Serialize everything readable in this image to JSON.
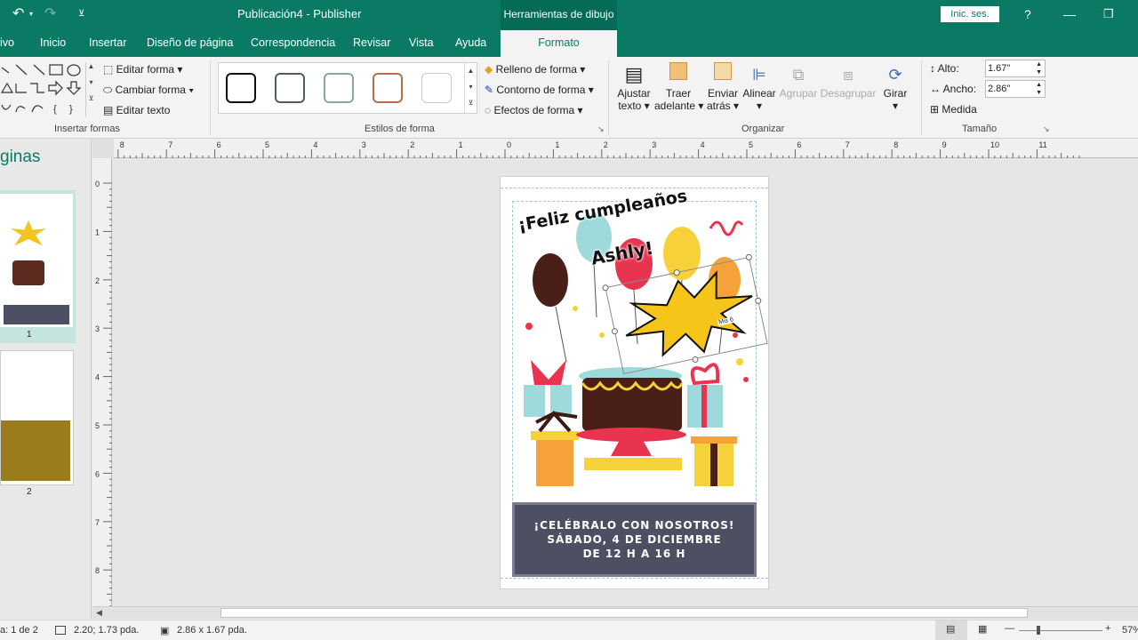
{
  "titlebar": {
    "doc_title": "Publicación4  -  Publisher",
    "drawing_tools": "Herramientas de dibujo",
    "signin": "Inic. ses.",
    "help": "?"
  },
  "tabs": [
    {
      "label": "ivo"
    },
    {
      "label": "Inicio"
    },
    {
      "label": "Insertar"
    },
    {
      "label": "Diseño de página"
    },
    {
      "label": "Correspondencia"
    },
    {
      "label": "Revisar"
    },
    {
      "label": "Vista"
    },
    {
      "label": "Ayuda"
    },
    {
      "label": "Formato"
    }
  ],
  "ribbon": {
    "insert_shapes": {
      "edit_shape": "Editar forma",
      "change_shape": "Cambiar forma",
      "edit_text": "Editar texto",
      "label": "Insertar formas"
    },
    "shape_styles": {
      "fill": "Relleno de forma",
      "outline": "Contorno de forma",
      "effects": "Efectos de forma",
      "label": "Estilos de forma",
      "swatch_colors": [
        "#111111",
        "#555b66",
        "#8aa6a8",
        "#b5704a",
        "#c8c8c8"
      ]
    },
    "arrange": {
      "wrap_text": "Ajustar",
      "wrap_text2": "texto",
      "bring_forward": "Traer",
      "bring_forward2": "adelante",
      "send_backward": "Enviar",
      "send_backward2": "atrás",
      "align": "Alinear",
      "group": "Agrupar",
      "ungroup": "Desagrupar",
      "rotate": "Girar",
      "label": "Organizar"
    },
    "size": {
      "height_label": "Alto:",
      "height_value": "1.67\"",
      "width_label": "Ancho:",
      "width_value": "2.86\"",
      "measure": "Medida",
      "label": "Tamaño"
    }
  },
  "pages_pane": {
    "title": "ginas",
    "thumb1_num": "1",
    "thumb2_num": "2"
  },
  "flyer": {
    "title_line1": "¡Feliz cumpleaños",
    "title_line2": "Ashly!",
    "burst_text": "Mis 6",
    "banner_line1": "¡CELÉBRALO CON NOSOTROS!",
    "banner_line2": "SÁBADO, 4 DE DICIEMBRE",
    "banner_line3": "DE 12 H A 16 H",
    "banner_color": "#4d4f63"
  },
  "ruler_labels": [
    "8",
    "7",
    "6",
    "5",
    "4",
    "3",
    "2",
    "1",
    "0",
    "1",
    "2",
    "3",
    "4",
    "5",
    "6",
    "7",
    "8",
    "9",
    "10",
    "11"
  ],
  "vruler_labels": [
    "0",
    "1",
    "2",
    "3",
    "4",
    "5",
    "6",
    "7",
    "8"
  ],
  "statusbar": {
    "page": "a: 1 de 2",
    "position": "2.20; 1.73 pda.",
    "size": "2.86 x  1.67 pda.",
    "zoom": "57%"
  }
}
